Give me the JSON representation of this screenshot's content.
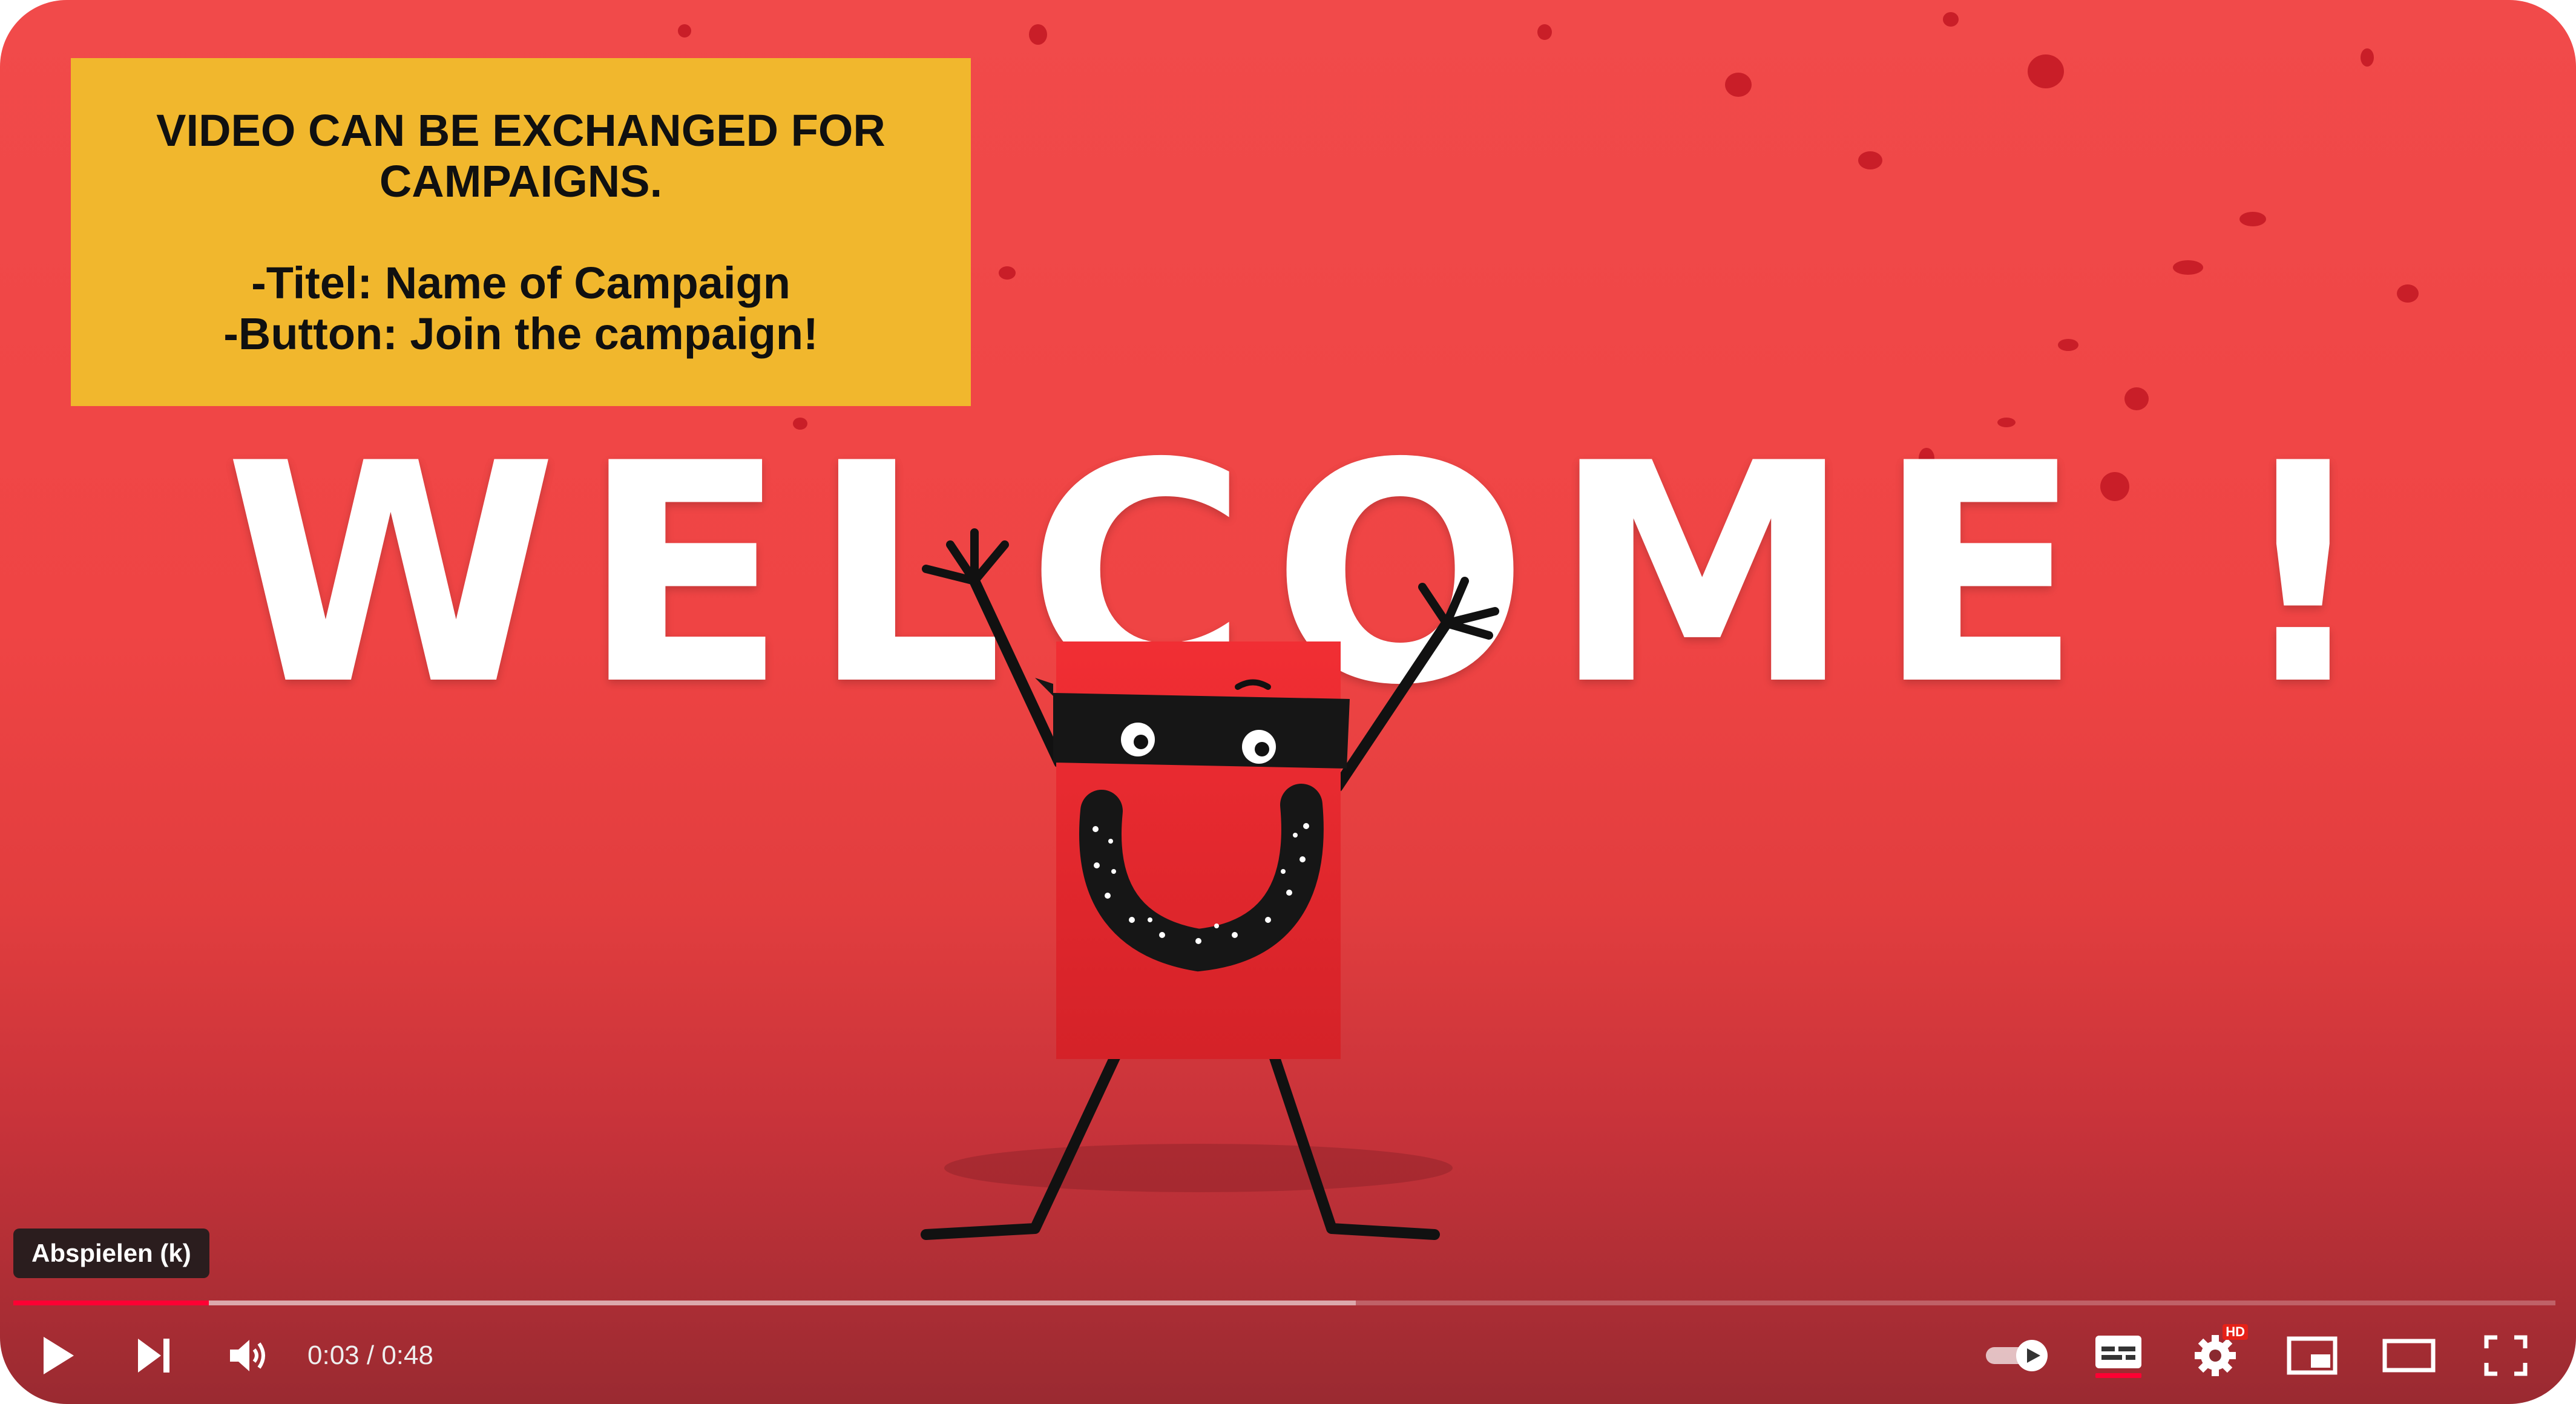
{
  "overlay_note": {
    "line1": "VIDEO CAN BE EXCHANGED FOR",
    "line2": "CAMPAIGNS.",
    "line3": "-Titel: Name of Campaign",
    "line4": "-Button: Join the campaign!",
    "background": "#f1b72d"
  },
  "video": {
    "headline": "WELCOME !",
    "background": "#ef4444",
    "mascot_color": "#e8262c"
  },
  "player": {
    "tooltip": "Abspielen (k)",
    "time_current": "0:03",
    "time_separator": " / ",
    "time_total": "0:48",
    "progress_played_fraction": 0.077,
    "progress_buffered_fraction": 0.528,
    "accent": "#ff0033",
    "hd_label": "HD",
    "icons": [
      "play-icon",
      "next-icon",
      "volume-icon",
      "autoplay-toggle-icon",
      "subtitles-icon",
      "settings-icon",
      "miniplayer-icon",
      "theater-mode-icon",
      "fullscreen-icon"
    ]
  }
}
